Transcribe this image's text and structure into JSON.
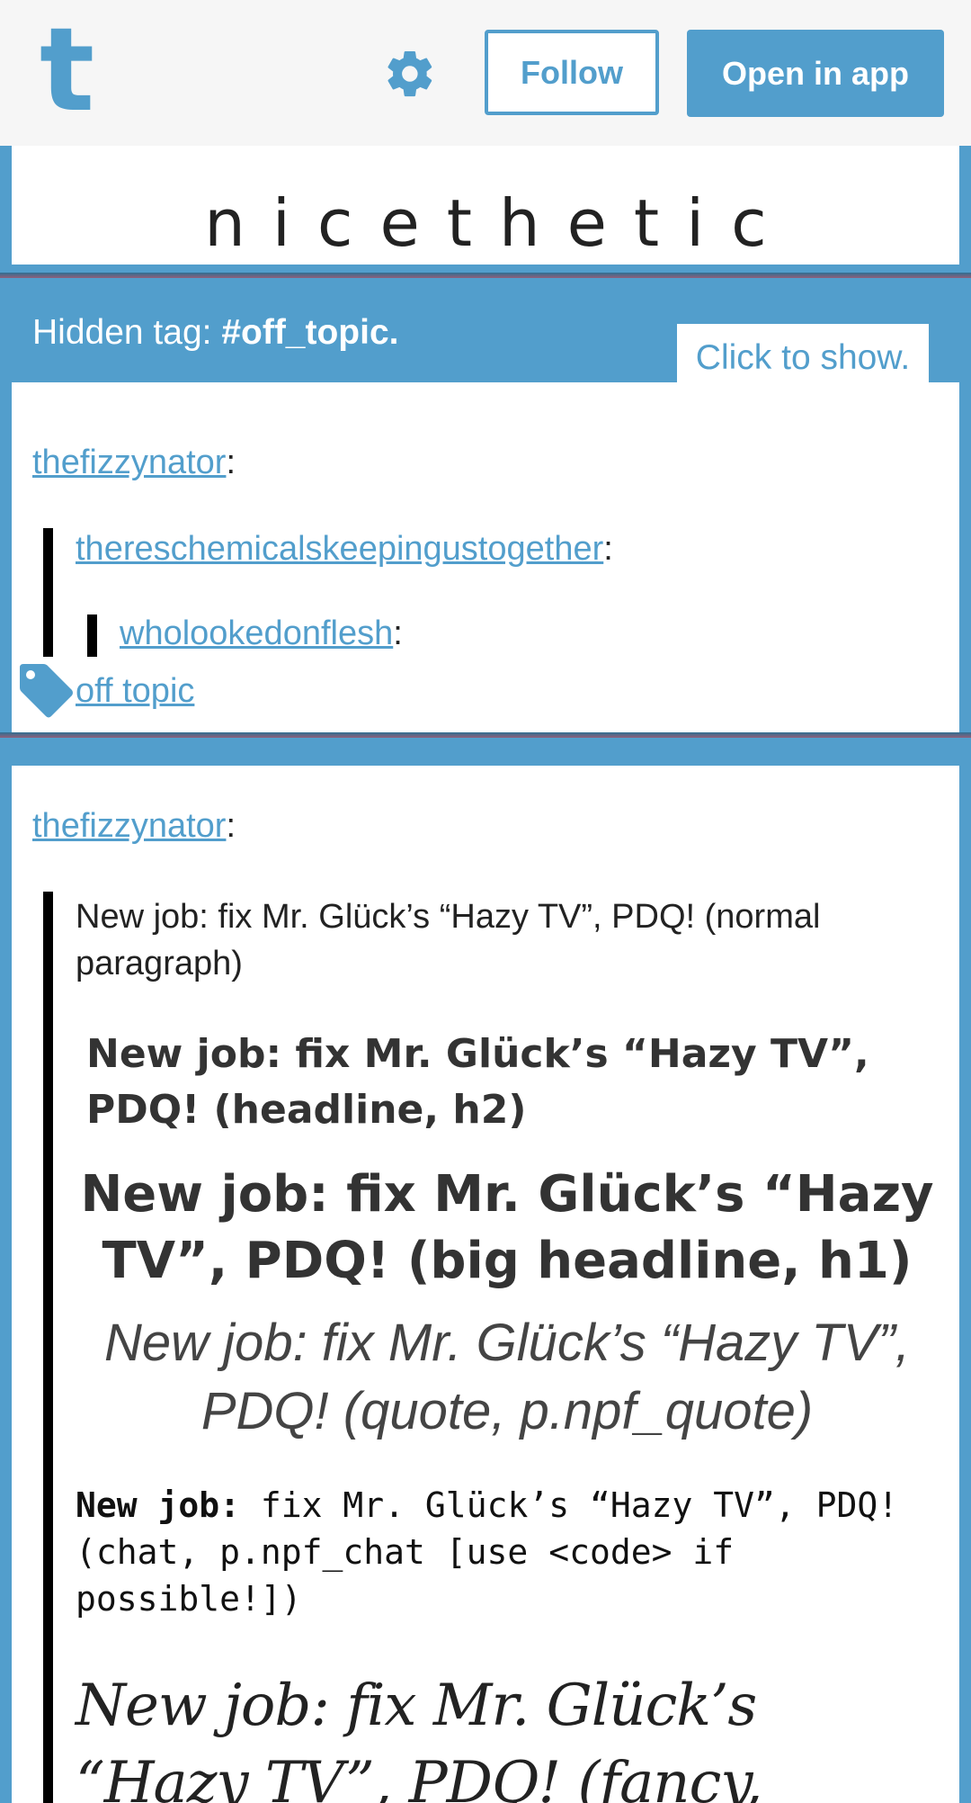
{
  "header": {
    "logo": "t",
    "settings_icon": "gear-icon",
    "follow_label": "Follow",
    "open_app_label": "Open in app"
  },
  "blog": {
    "title": "nicethetic"
  },
  "hidden_notice": {
    "prefix": "Hidden tag: ",
    "tag": "#off_topic.",
    "show_label": "Click to show."
  },
  "post1": {
    "author": "thefizzynator",
    "reblog1_author": "thereschemicalskeepingustogether",
    "reblog2_author": "wholookedonflesh",
    "tag_icon": "tag-icon",
    "tag": "off topic"
  },
  "post2": {
    "author": "thefizzynator",
    "normal": "New job: fix Mr. Glück’s “Hazy TV”, PDQ! (normal paragraph)",
    "h2": "New job: fix Mr. Glück’s “Hazy TV”, PDQ! (headline, h2)",
    "h1": "New job: fix Mr. Glück’s “Hazy TV”, PDQ! (big headline, h1)",
    "quote": "New job: fix Mr. Glück’s “Hazy TV”, PDQ! (quote, p.npf_quote)",
    "chat_label": "New job:",
    "chat_rest": " fix Mr. Glück’s “Hazy TV”, PDQ! (chat, p.npf_chat [use <code> if possible!])",
    "fancy": "New job: fix Mr. Glück’s “Hazy TV”, PDQ! (fancy,"
  }
}
